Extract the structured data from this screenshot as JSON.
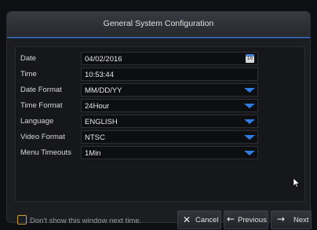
{
  "dialog": {
    "title": "General System Configuration"
  },
  "fields": [
    {
      "label": "Date",
      "value": "04/02/2016",
      "type": "date",
      "icon": "calendar-icon",
      "icon_text": "10"
    },
    {
      "label": "Time",
      "value": "10:53:44",
      "type": "text"
    },
    {
      "label": "Date Format",
      "value": "MM/DD/YY",
      "type": "select"
    },
    {
      "label": "Time Format",
      "value": "24Hour",
      "type": "select"
    },
    {
      "label": "Language",
      "value": "ENGLISH",
      "type": "select"
    },
    {
      "label": "Video Format",
      "value": "NTSC",
      "type": "select"
    },
    {
      "label": "Menu Timeouts",
      "value": "1Min",
      "type": "select"
    }
  ],
  "footer": {
    "checkbox_label": "Don't show this window next time.",
    "cancel_label": "Cancel",
    "previous_label": "Previous",
    "next_label": "Next"
  },
  "colors": {
    "accent": "#2f7de0",
    "checkbox": "#c9a13a"
  }
}
